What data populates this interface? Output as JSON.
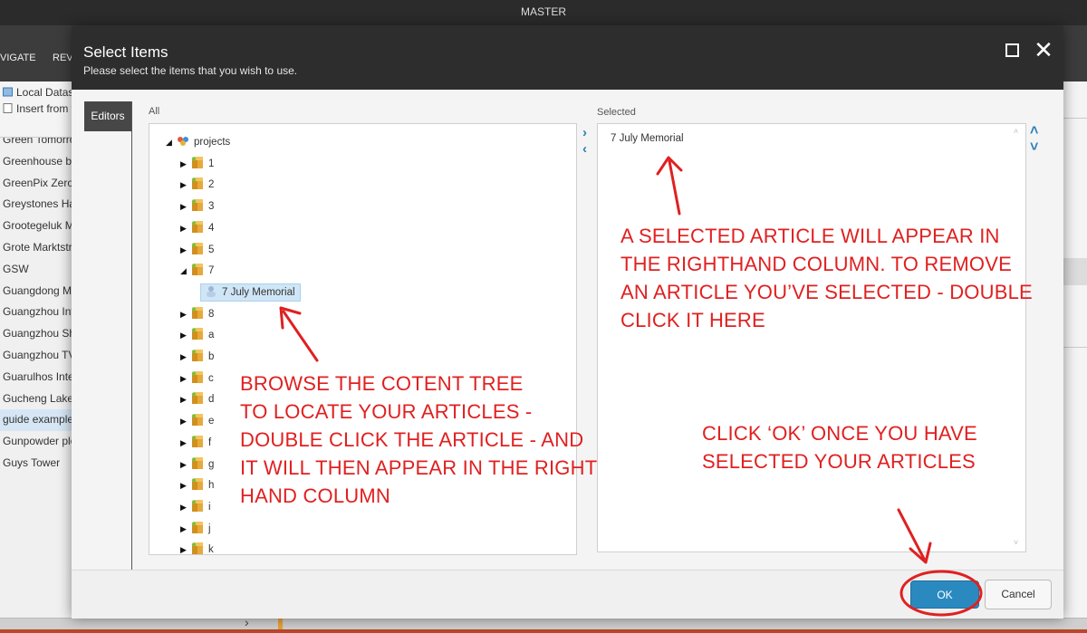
{
  "app": {
    "title": "MASTER",
    "ribbon_tabs": [
      "VIGATE",
      "REVI"
    ],
    "toolbar": [
      "Local Datasc",
      "Insert from t"
    ],
    "left_list": [
      {
        "label": "Green Tomorro",
        "active": false
      },
      {
        "label": "Greenhouse by",
        "active": false
      },
      {
        "label": "GreenPix Zero",
        "active": false
      },
      {
        "label": "Greystones Ha",
        "active": false
      },
      {
        "label": "Grootegeluk M",
        "active": false
      },
      {
        "label": "Grote Marktstr",
        "active": false
      },
      {
        "label": "GSW",
        "active": false
      },
      {
        "label": "Guangdong Mu",
        "active": false
      },
      {
        "label": "Guangzhou Int",
        "active": false
      },
      {
        "label": "Guangzhou She",
        "active": false
      },
      {
        "label": "Guangzhou TV",
        "active": false
      },
      {
        "label": "Guarulhos Inte",
        "active": false
      },
      {
        "label": "Gucheng Lake",
        "active": false
      },
      {
        "label": "guide example",
        "active": true
      },
      {
        "label": "Gunpowder plo",
        "active": false
      },
      {
        "label": "Guys Tower",
        "active": false
      }
    ],
    "bottom_chevron": "›"
  },
  "dialog": {
    "title": "Select Items",
    "subtitle": "Please select the items that you wish to use.",
    "maximize_icon": "maximize-icon",
    "close_icon": "close-icon",
    "close_glyph": "✕",
    "editors_tab": "Editors",
    "all_label": "All",
    "selected_label": "Selected",
    "tree": [
      {
        "label": "projects",
        "caret": "◢",
        "level": 0,
        "icon": "projects-icon"
      },
      {
        "label": "1",
        "caret": "▶",
        "level": 1,
        "icon": "package-icon"
      },
      {
        "label": "2",
        "caret": "▶",
        "level": 1,
        "icon": "package-icon"
      },
      {
        "label": "3",
        "caret": "▶",
        "level": 1,
        "icon": "package-icon"
      },
      {
        "label": "4",
        "caret": "▶",
        "level": 1,
        "icon": "package-icon"
      },
      {
        "label": "5",
        "caret": "▶",
        "level": 1,
        "icon": "package-icon"
      },
      {
        "label": "7",
        "caret": "◢",
        "level": 1,
        "icon": "package-icon"
      },
      {
        "label": "7 July Memorial",
        "caret": "",
        "level": 2,
        "icon": "article-icon",
        "selected": true
      },
      {
        "label": "8",
        "caret": "▶",
        "level": 1,
        "icon": "package-icon"
      },
      {
        "label": "a",
        "caret": "▶",
        "level": 1,
        "icon": "package-icon"
      },
      {
        "label": "b",
        "caret": "▶",
        "level": 1,
        "icon": "package-icon"
      },
      {
        "label": "c",
        "caret": "▶",
        "level": 1,
        "icon": "package-icon"
      },
      {
        "label": "d",
        "caret": "▶",
        "level": 1,
        "icon": "package-icon"
      },
      {
        "label": "e",
        "caret": "▶",
        "level": 1,
        "icon": "package-icon"
      },
      {
        "label": "f",
        "caret": "▶",
        "level": 1,
        "icon": "package-icon"
      },
      {
        "label": "g",
        "caret": "▶",
        "level": 1,
        "icon": "package-icon"
      },
      {
        "label": "h",
        "caret": "▶",
        "level": 1,
        "icon": "package-icon"
      },
      {
        "label": "i",
        "caret": "▶",
        "level": 1,
        "icon": "package-icon"
      },
      {
        "label": "j",
        "caret": "▶",
        "level": 1,
        "icon": "package-icon"
      },
      {
        "label": "k",
        "caret": "▶",
        "level": 1,
        "icon": "package-icon"
      }
    ],
    "move_right": "›",
    "move_left": "‹",
    "move_up": "˄",
    "move_down": "˅",
    "selected_items": [
      "7 July Memorial"
    ],
    "ok_label": "OK",
    "cancel_label": "Cancel"
  },
  "annotations": {
    "right_note": "A SELECTED ARTICLE WILL APPEAR IN\nTHE RIGHTHAND COLUMN. TO REMOVE\nAN ARTICLE YOU’VE SELECTED - DOUBLE\nCLICK IT HERE",
    "tree_note": "BROWSE THE COTENT TREE\nTO LOCATE YOUR ARTICLES -\nDOUBLE CLICK THE ARTICLE - AND\nIT WILL THEN APPEAR IN THE RIGHT\nHAND COLUMN",
    "ok_note": "CLICK ‘OK’ ONCE YOU HAVE\nSELECTED YOUR ARTICLES",
    "color": "#e02020"
  },
  "colors": {
    "accent": "#2a8ac0",
    "header": "#2d2d2d",
    "selection": "#cfe6f7"
  }
}
